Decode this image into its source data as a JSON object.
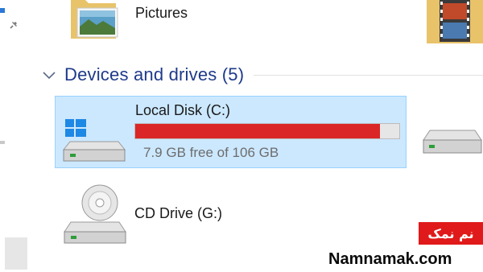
{
  "quick_access": {
    "pictures": {
      "label": "Pictures",
      "icon": "pictures-folder-icon"
    },
    "videos": {
      "icon": "videos-folder-icon"
    }
  },
  "devices_group": {
    "title": "Devices and drives (5)",
    "chevron_icon": "chevron-down-icon"
  },
  "drives": [
    {
      "name": "Local Disk (C:)",
      "free_text": "7.9 GB free of 106 GB",
      "used_fraction": 0.926,
      "bar_color": "#da2626",
      "icon": "windows-hard-drive-icon",
      "selected": true
    },
    {
      "icon": "hard-drive-icon"
    },
    {
      "name": "CD Drive (G:)",
      "icon": "cd-drive-icon"
    }
  ],
  "watermark": {
    "persian": "نم نمک",
    "site": "Namnamak.com"
  },
  "colors": {
    "selection_bg": "#cce8ff",
    "selection_border": "#99d1ff",
    "group_title": "#1e3a8a",
    "usage_bar_full": "#da2626"
  }
}
